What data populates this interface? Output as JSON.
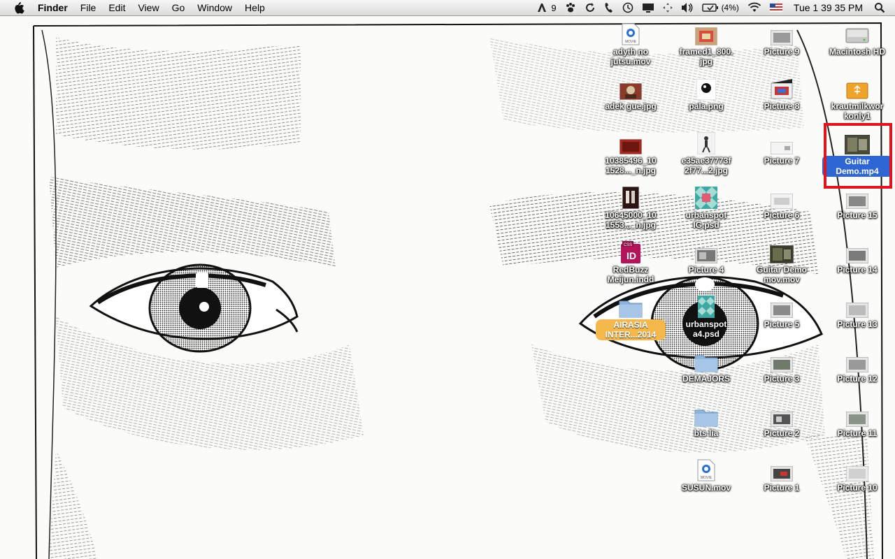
{
  "menubar": {
    "app_name": "Finder",
    "menus": [
      "File",
      "Edit",
      "View",
      "Go",
      "Window",
      "Help"
    ],
    "adobe_badge": "9",
    "battery": "(4%)",
    "clock": "Tue 1 39 35 PM"
  },
  "desktop": {
    "col1": [
      {
        "label": "adyth no jutsu.mov",
        "kind": "movie"
      },
      {
        "label": "adek gue.jpg",
        "kind": "photo-red"
      },
      {
        "label": "10385496_10 1528..._n.jpg",
        "kind": "photo-red"
      },
      {
        "label": "10645000_10 1553..._n.jpg",
        "kind": "photo-dark"
      },
      {
        "label": "RedBuzz Meijun.indd",
        "kind": "indesign"
      },
      {
        "label": "AIRASIA INTER...2014",
        "kind": "folder",
        "tag": "orange"
      }
    ],
    "col2": [
      {
        "label": "framed1_800. jpg",
        "kind": "photo-tan"
      },
      {
        "label": "pala.png",
        "kind": "photo-white"
      },
      {
        "label": "e35ae37773f 2f77...2.jpg",
        "kind": "photo-figure"
      },
      {
        "label": "urbanspot IG.psd",
        "kind": "pattern"
      },
      {
        "label": "Picture 4",
        "kind": "screenshot"
      },
      {
        "label": "urbanspot a4.psd",
        "kind": "pattern"
      },
      {
        "label": "DEMAJORS",
        "kind": "folder"
      },
      {
        "label": "bts lia",
        "kind": "folder"
      },
      {
        "label": "SUSUN.mov",
        "kind": "movie"
      }
    ],
    "col3": [
      {
        "label": "Picture 9",
        "kind": "screenshot"
      },
      {
        "label": "Picture 8",
        "kind": "clapper"
      },
      {
        "label": "Picture 7",
        "kind": "screenshot-light"
      },
      {
        "label": "Picture 6",
        "kind": "screenshot-light"
      },
      {
        "label": "Guitar Demo mov.mov",
        "kind": "video"
      },
      {
        "label": "Picture 5",
        "kind": "screenshot"
      },
      {
        "label": "Picture 3",
        "kind": "screenshot"
      },
      {
        "label": "Picture 2",
        "kind": "screenshot"
      },
      {
        "label": "Picture 1",
        "kind": "screenshot"
      }
    ],
    "col4": [
      {
        "label": "Macintosh HD",
        "kind": "harddisk"
      },
      {
        "label": "krautmilkwor konly1",
        "kind": "usb"
      },
      {
        "label": "Guitar Demo.mp4",
        "kind": "video",
        "selected": true
      },
      {
        "label": "Picture 15",
        "kind": "screenshot"
      },
      {
        "label": "Picture 14",
        "kind": "screenshot"
      },
      {
        "label": "Picture 13",
        "kind": "screenshot"
      },
      {
        "label": "Picture 12",
        "kind": "screenshot"
      },
      {
        "label": "Picture 11",
        "kind": "screenshot"
      },
      {
        "label": "Picture 10",
        "kind": "screenshot"
      }
    ]
  },
  "colors": {
    "selection": "#2e67d3",
    "folder": "#8fb4db",
    "highlight_box": "#e0141e",
    "tag_orange": "#f5b84c"
  }
}
